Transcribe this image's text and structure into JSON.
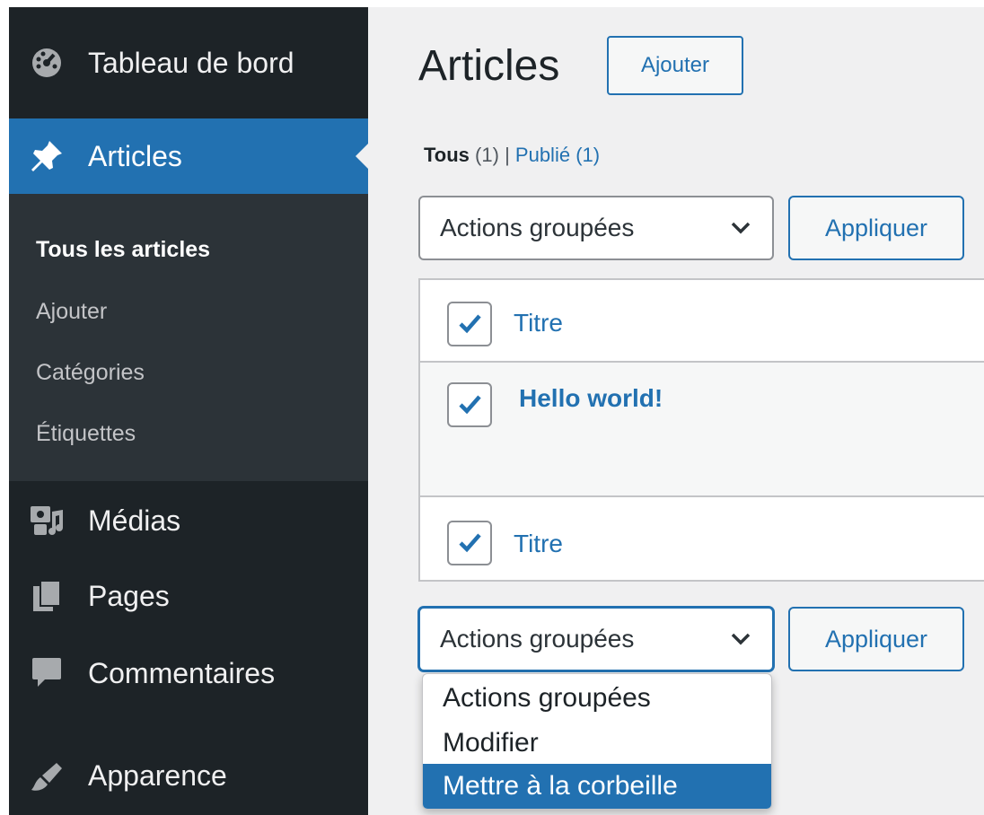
{
  "sidebar": {
    "dashboard": "Tableau de bord",
    "articles": "Articles",
    "submenu": [
      "Tous les articles",
      "Ajouter",
      "Catégories",
      "Étiquettes"
    ],
    "media": "Médias",
    "pages": "Pages",
    "comments": "Commentaires",
    "appearance": "Apparence"
  },
  "header": {
    "title": "Articles",
    "add_button": "Ajouter"
  },
  "filters": {
    "all_label": "Tous",
    "all_count": "(1)",
    "separator": "|",
    "published_label": "Publié",
    "published_count": "(1)"
  },
  "bulk_top": {
    "selected": "Actions groupées",
    "apply": "Appliquer"
  },
  "table": {
    "header_title": "Titre",
    "rows": [
      {
        "title": "Hello world!",
        "checked": true
      }
    ],
    "footer_title": "Titre"
  },
  "bulk_bottom": {
    "selected": "Actions groupées",
    "apply": "Appliquer",
    "options": [
      "Actions groupées",
      "Modifier",
      "Mettre à la corbeille"
    ],
    "highlighted": "Mettre à la corbeille"
  },
  "colors": {
    "accent": "#2271b1",
    "sidebar_bg": "#1d2327",
    "submenu_bg": "#2c3338",
    "content_bg": "#f0f0f1"
  },
  "icons": {
    "dashboard": "dashboard-gauge-icon",
    "articles": "pushpin-icon",
    "media": "media-icon",
    "pages": "pages-icon",
    "comments": "comment-bubble-icon",
    "appearance": "paintbrush-icon",
    "chevron": "chevron-down-icon",
    "check": "checkmark-icon"
  }
}
